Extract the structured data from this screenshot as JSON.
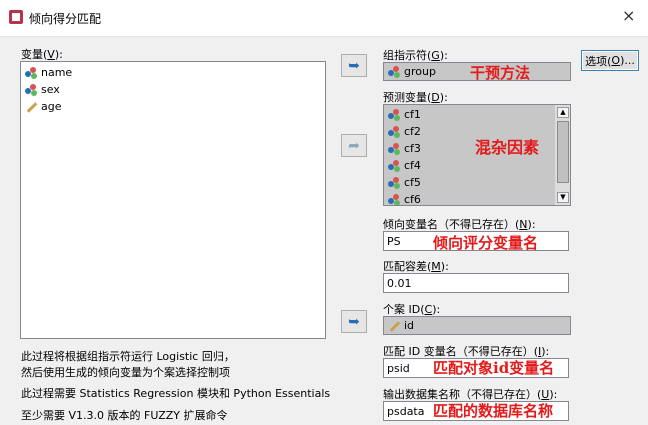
{
  "window": {
    "title": "倾向得分匹配",
    "close_glyph": "×"
  },
  "variables": {
    "label_pre": "变量(",
    "label_key": "V",
    "label_post": "):",
    "items": [
      {
        "name": "name",
        "icon": "nominal-variable-icon"
      },
      {
        "name": "sex",
        "icon": "nominal-variable-icon"
      },
      {
        "name": "age",
        "icon": "scale-variable-icon"
      }
    ]
  },
  "group_indicator": {
    "label_pre": "组指示符(",
    "label_key": "G",
    "label_post": "):",
    "value": "group",
    "annotation": "干预方法"
  },
  "predictors": {
    "label_pre": "预测变量(",
    "label_key": "D",
    "label_post": "):",
    "items": [
      "cf1",
      "cf2",
      "cf3",
      "cf4",
      "cf5",
      "cf6"
    ],
    "annotation": "混杂因素"
  },
  "propensity_name": {
    "label_pre": "倾向变量名（不得已存在）(",
    "label_key": "N",
    "label_post": "):",
    "value": "PS",
    "annotation": "倾向评分变量名"
  },
  "tolerance": {
    "label_pre": "匹配容差(",
    "label_key": "M",
    "label_post": "):",
    "value": "0.01"
  },
  "case_id": {
    "label_pre": "个案 ID(",
    "label_key": "C",
    "label_post": "):",
    "value": "id"
  },
  "match_id": {
    "label_pre": "匹配 ID 变量名（不得已存在）(",
    "label_key": "I",
    "label_post": "):",
    "value": "psid",
    "annotation": "匹配对象id变量名"
  },
  "output_dataset": {
    "label_pre": "输出数据集名称（不得已存在）(",
    "label_key": "U",
    "label_post": "):",
    "value": "psdata",
    "annotation": "匹配的数据库名称"
  },
  "options_button": {
    "label_pre": "选项(",
    "label_key": "O",
    "label_post": ")..."
  },
  "info": {
    "line1": "此过程将根据组指示符运行 Logistic 回归，",
    "line2": "然后使用生成的倾向变量为个案选择控制项",
    "line3": "此过程需要 Statistics Regression 模块和 Python Essentials",
    "line4": "至少需要 V1.3.0 版本的 FUZZY 扩展命令"
  },
  "arrows": {
    "move_right": "➦",
    "move_left": "➥"
  },
  "colors": {
    "annotation_red": "#e41b1b",
    "title_icon": "#b8334a"
  }
}
